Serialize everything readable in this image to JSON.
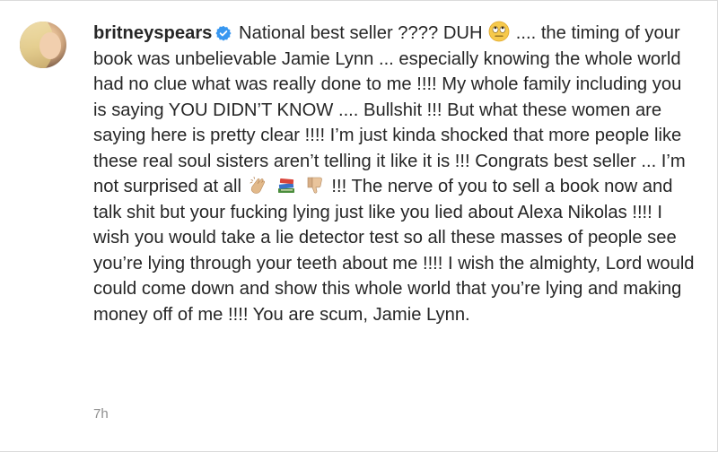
{
  "post_comment": {
    "username": "britneyspears",
    "verified_icon": "verified-badge-icon",
    "segments": {
      "s1": "National best seller ???? DUH",
      "s2": ".... the timing of your book was unbelievable Jamie Lynn ... especially knowing the whole world had no clue what was really done to me !!!! My whole family including you is saying YOU DIDN’T KNOW .... Bullshit !!! But what these women are saying here is pretty clear !!!! I’m just kinda shocked that more people like these real soul sisters aren’t telling it like it is !!! Congrats best seller ... I’m not surprised at all",
      "s3": "!!! The nerve of you to sell a book now and talk shit but your fucking lying just like you lied about Alexa Nikolas !!!! I wish you would take a lie detector test so all these masses of people see you’re lying through your teeth about me !!!! I wish the almighty, Lord would could come down and show this whole world that you’re lying and making money off of me !!!! You are scum, Jamie Lynn."
    },
    "emojis": [
      "face-with-rolling-eyes-emoji",
      "clapping-hands-emoji",
      "books-emoji",
      "thumbs-down-emoji"
    ],
    "timestamp": "7h"
  },
  "colors": {
    "text": "#262626",
    "muted": "#8e8e8e",
    "verified": "#3897f0"
  }
}
